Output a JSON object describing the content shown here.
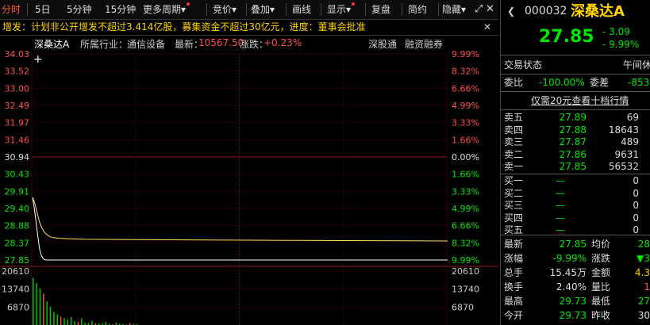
{
  "toolbar": {
    "items": [
      {
        "label": "分时",
        "active": true
      },
      {
        "label": "5日"
      },
      {
        "label": "5分钟"
      },
      {
        "label": "15分钟"
      },
      {
        "label": "更多周期"
      },
      {
        "label": "竞价"
      },
      {
        "label": "叠加"
      },
      {
        "label": "画线"
      },
      {
        "label": "显示"
      },
      {
        "label": "复盘"
      },
      {
        "label": "简约"
      },
      {
        "label": "隐藏"
      }
    ],
    "fullscreen_icon": "fullscreen-icon",
    "close_icon": "close-icon"
  },
  "notice": {
    "text": "增发：计划非公开增发不超过3.414亿股，募集资金不超过30亿元，进度：董事会批准",
    "close_icon": "close-icon"
  },
  "chart_header": {
    "stock": "深桑达A",
    "industry_label": "所属行业：",
    "industry": "通信设备",
    "latest_label": "最新：",
    "latest": "10567.50",
    "change_label": "涨跌：",
    "change": "+0.23%",
    "link1": "深股通",
    "link2": "融资融券"
  },
  "chart_data": {
    "type": "line",
    "title": "",
    "xlabel": "",
    "ylabel": "",
    "prev_close": 30.94,
    "ylim": [
      27.85,
      34.03
    ],
    "price_ticks": [
      "34.03",
      "33.52",
      "33.00",
      "32.49",
      "31.97",
      "31.46",
      "30.94",
      "30.43",
      "29.91",
      "29.40",
      "28.88",
      "28.37",
      "27.85"
    ],
    "pct_ticks": [
      "9.99%",
      "8.32%",
      "6.66%",
      "4.99%",
      "3.33%",
      "1.66%",
      "0.00%",
      "1.66%",
      "3.33%",
      "4.99%",
      "6.66%",
      "8.32%",
      "9.99%"
    ],
    "volume_ticks": [
      "20610",
      "13740",
      "6870"
    ],
    "x": [
      0,
      1,
      2,
      3,
      4,
      5,
      6,
      7,
      8,
      10,
      12,
      16,
      20,
      30,
      60,
      100,
      150,
      193,
      240
    ],
    "price": [
      29.73,
      29.4,
      29.0,
      28.6,
      28.2,
      28.0,
      27.9,
      27.86,
      27.85,
      27.85,
      27.85,
      27.85,
      27.85,
      27.85,
      27.85,
      27.85,
      27.85,
      27.85,
      27.85
    ],
    "avg": [
      29.73,
      29.6,
      29.4,
      29.2,
      29.0,
      28.85,
      28.75,
      28.68,
      28.62,
      28.55,
      28.52,
      28.5,
      28.49,
      28.47,
      28.46,
      28.45,
      28.44,
      28.43,
      28.42
    ],
    "volume_max": 20610,
    "volume": [
      18000,
      16000,
      14000,
      12000,
      9000,
      7000,
      5000,
      4000,
      3200,
      2600,
      2000,
      3000,
      1500,
      1200,
      2500,
      900,
      800,
      1600,
      700,
      600,
      500,
      1100,
      400,
      300,
      900,
      500,
      300,
      200,
      700,
      400,
      300
    ]
  },
  "quote": {
    "code": "000032",
    "name": "深桑达A",
    "price": "27.85",
    "change": "- 3.09",
    "pct": "- 9.99%",
    "status_label": "交易状态",
    "status": "午间休",
    "weibi_label": "委比",
    "weibi": "-100.00%",
    "weicha_label": "委差",
    "weicha": "-853",
    "link": "仅需20元查看十档行情",
    "asks": [
      {
        "label": "卖五",
        "price": "27.89",
        "vol": "69"
      },
      {
        "label": "卖四",
        "price": "27.88",
        "vol": "18643"
      },
      {
        "label": "卖三",
        "price": "27.87",
        "vol": "489"
      },
      {
        "label": "卖二",
        "price": "27.86",
        "vol": "9631"
      },
      {
        "label": "卖一",
        "price": "27.85",
        "vol": "56532"
      }
    ],
    "bids": [
      {
        "label": "买一",
        "price": "—",
        "vol": "0"
      },
      {
        "label": "买二",
        "price": "—",
        "vol": "0"
      },
      {
        "label": "买三",
        "price": "—",
        "vol": "0"
      },
      {
        "label": "买四",
        "price": "—",
        "vol": "0"
      },
      {
        "label": "买五",
        "price": "—",
        "vol": "0"
      }
    ],
    "stats": [
      {
        "l1": "最新",
        "v1": "27.85",
        "c1": "g",
        "l2": "均价",
        "v2": "28",
        "c2": "g"
      },
      {
        "l1": "涨幅",
        "v1": "-9.99%",
        "c1": "g",
        "l2": "涨跌",
        "v2": "▼3",
        "c2": "g"
      },
      {
        "l1": "总手",
        "v1": "15.45万",
        "c1": "w",
        "l2": "金额",
        "v2": "4.3",
        "c2": "y"
      },
      {
        "l1": "换手",
        "v1": "2.40%",
        "c1": "w",
        "l2": "量比",
        "v2": "1",
        "c2": "r"
      },
      {
        "l1": "最高",
        "v1": "29.73",
        "c1": "g",
        "l2": "最低",
        "v2": "27",
        "c2": "g"
      },
      {
        "l1": "今开",
        "v1": "29.73",
        "c1": "g",
        "l2": "昨收",
        "v2": "30",
        "c2": "w"
      }
    ]
  },
  "colors": {
    "up": "#ff4d4d",
    "down": "#00e600",
    "price_line": "#ffffff",
    "avg_line": "#ffe05a",
    "grid": "#3a0000",
    "accent": "#ff5a36"
  }
}
